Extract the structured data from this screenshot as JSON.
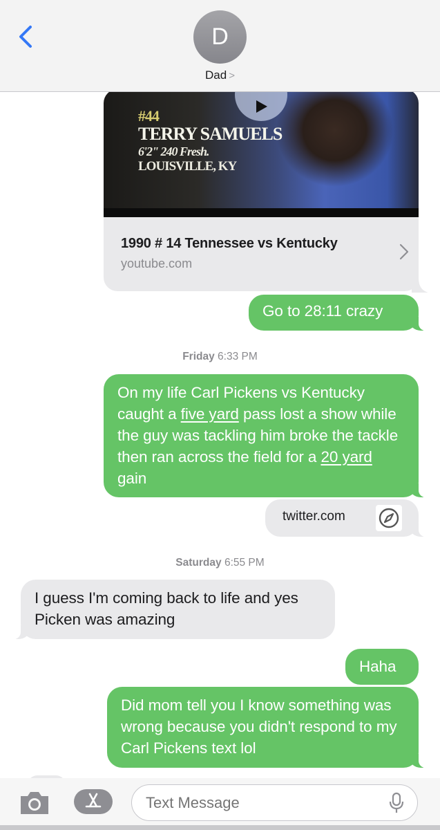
{
  "header": {
    "avatar_initial": "D",
    "contact_name": "Dad",
    "contact_chevron": ">"
  },
  "link_preview": {
    "thumb": {
      "jersey": "#44",
      "name": "TERRY SAMUELS",
      "stats": "6'2\" 240 Fresh.",
      "hometown": "LOUISVILLE, KY"
    },
    "title": "1990 # 14 Tennessee vs Kentucky",
    "domain": "youtube.com"
  },
  "messages": {
    "m1": "Go to 28:11 crazy",
    "ts1_day": "Friday",
    "ts1_time": "6:33 PM",
    "m2_a": "On my life Carl Pickens vs Kentucky caught a ",
    "m2_link1": "five yard",
    "m2_b": " pass lost a show while the guy was tackling him broke the tackle then ran across the field for a ",
    "m2_link2": "20 yard",
    "m2_c": " gain",
    "twitter_domain": "twitter.com",
    "ts2_day": "Saturday",
    "ts2_time": "6:55 PM",
    "m3": "I guess I'm  coming back to life and yes Picken was amazing",
    "m4": "Haha",
    "m5": "Did mom tell you I know something was wrong because you didn't respond to my Carl Pickens text lol"
  },
  "input": {
    "placeholder": "Text Message"
  },
  "icons": {
    "back": "chevron-left-icon",
    "play": "play-icon",
    "card_chevron": "chevron-right-icon",
    "compass": "safari-compass-icon",
    "camera": "camera-icon",
    "apps": "app-store-icon",
    "mic": "microphone-icon"
  },
  "colors": {
    "sent_bubble": "#65c466",
    "received_bubble": "#e9e9eb",
    "accent_blue": "#3478f6"
  }
}
